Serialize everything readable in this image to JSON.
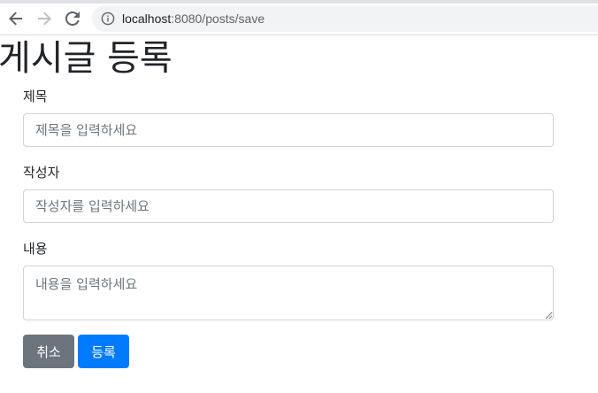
{
  "browser": {
    "url_host": "localhost",
    "url_path": ":8080/posts/save",
    "icons": {
      "back": "arrow-left-icon",
      "forward": "arrow-right-icon",
      "reload": "reload-icon",
      "site_info": "info-icon"
    }
  },
  "page": {
    "title": "게시글 등록"
  },
  "form": {
    "title_label": "제목",
    "title_placeholder": "제목을 입력하세요",
    "title_value": "",
    "author_label": "작성자",
    "author_placeholder": "작성자를 입력하세요",
    "author_value": "",
    "content_label": "내용",
    "content_placeholder": "내용을 입력하세요",
    "content_value": ""
  },
  "buttons": {
    "cancel_label": "취소",
    "save_label": "등록"
  },
  "colors": {
    "cancel_bg": "#6c757d",
    "save_bg": "#007bff",
    "input_border": "#ced4da"
  }
}
